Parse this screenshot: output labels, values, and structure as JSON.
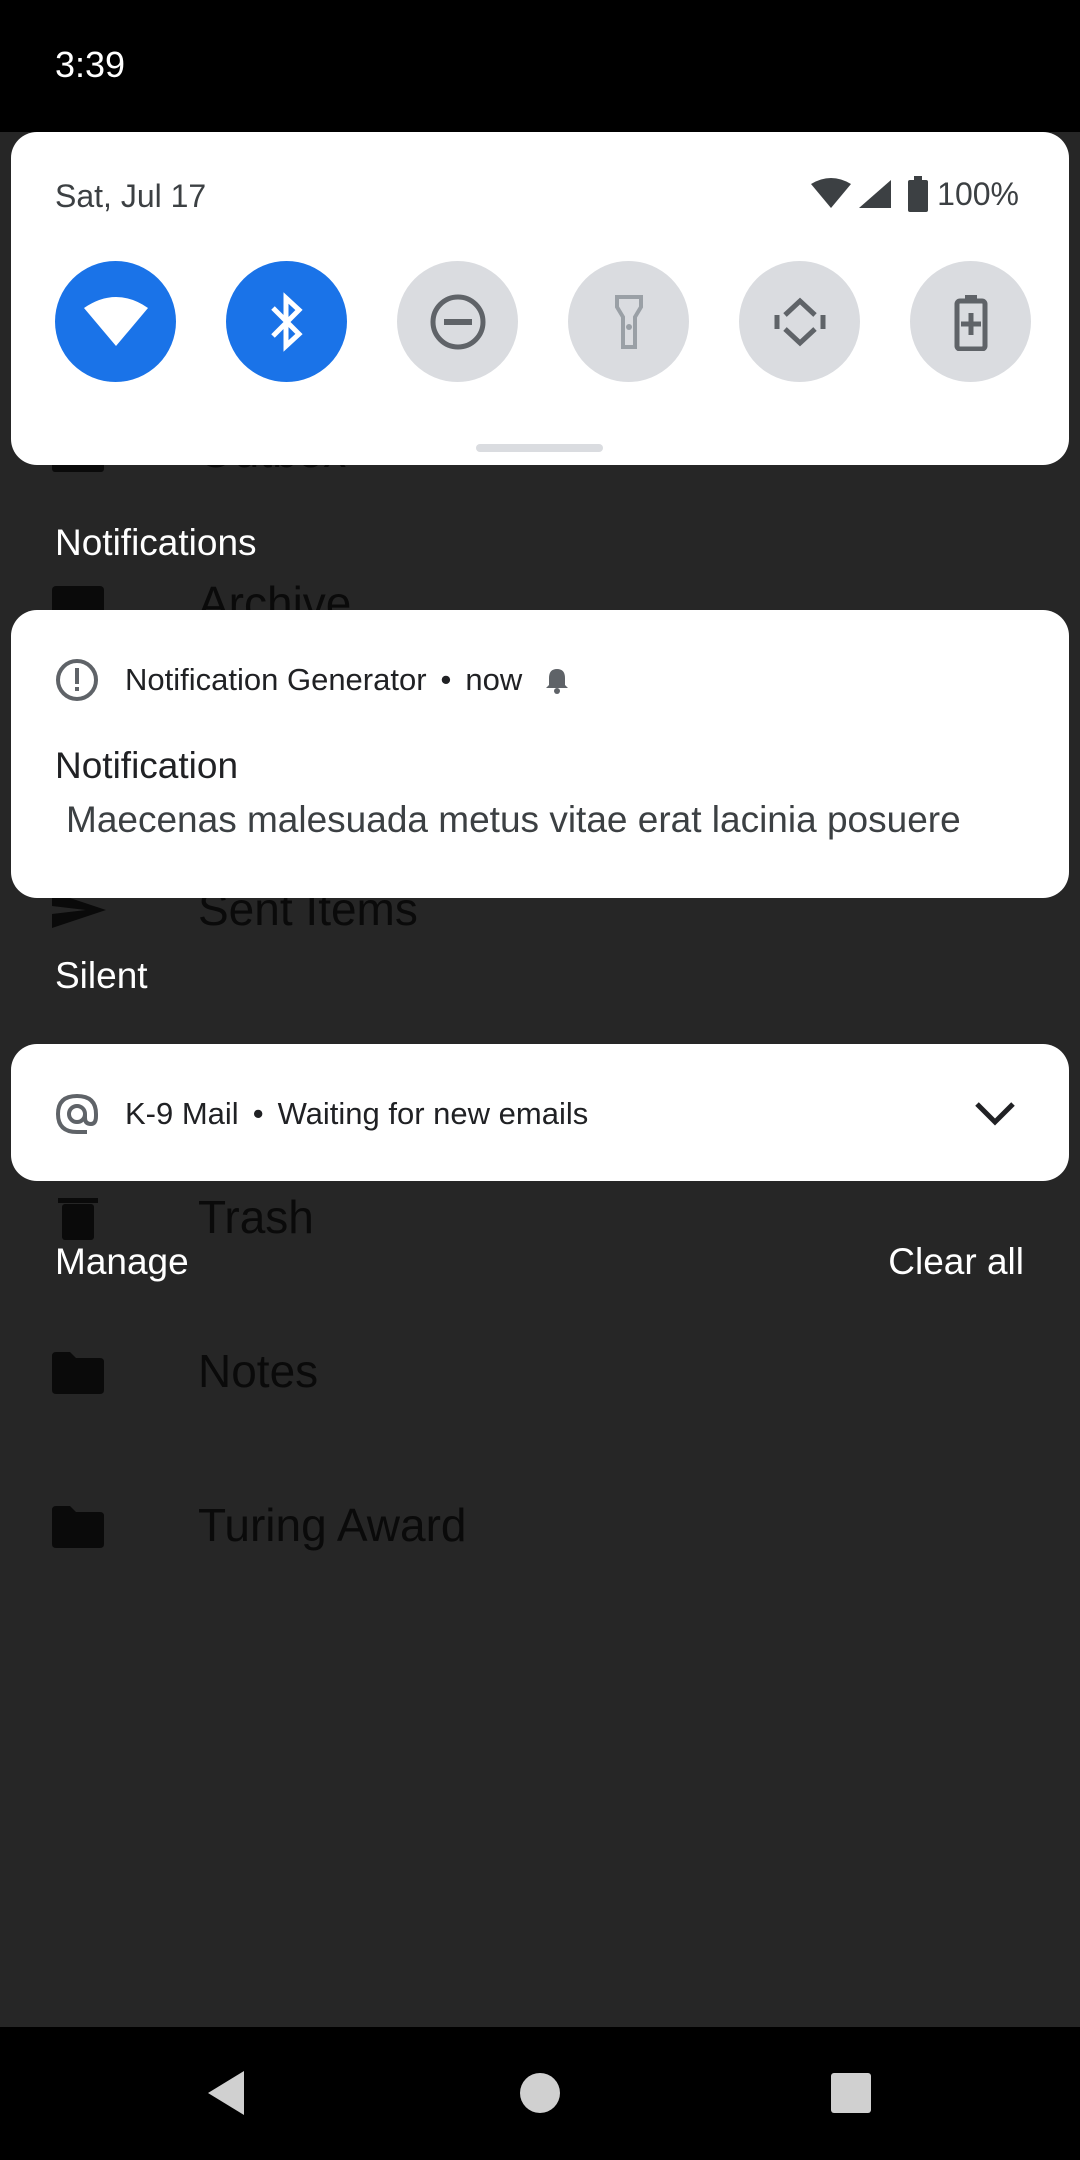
{
  "status_bar": {
    "time": "3:39"
  },
  "background_app": {
    "folders": [
      {
        "label": "Outbox",
        "icon": "outbox-icon"
      },
      {
        "label": "Archive",
        "icon": "archive-icon"
      },
      {
        "label": "Sent Items",
        "icon": "send-icon"
      },
      {
        "label": "Trash",
        "icon": "trash-icon"
      },
      {
        "label": "Notes",
        "icon": "folder-icon"
      },
      {
        "label": "Turing Award",
        "icon": "folder-icon"
      }
    ]
  },
  "quick_settings": {
    "date": "Sat, Jul 17",
    "battery_percent": "100%",
    "tiles": [
      {
        "name": "wifi",
        "icon": "wifi-icon",
        "active": true
      },
      {
        "name": "bluetooth",
        "icon": "bluetooth-icon",
        "active": true
      },
      {
        "name": "do-not-disturb",
        "icon": "do-not-disturb-icon",
        "active": false
      },
      {
        "name": "flashlight",
        "icon": "flashlight-icon",
        "active": false
      },
      {
        "name": "auto-rotate",
        "icon": "auto-rotate-icon",
        "active": false
      },
      {
        "name": "battery-saver",
        "icon": "battery-saver-icon",
        "active": false
      }
    ],
    "accent_color": "#1a73e8",
    "inactive_color": "#dadce0"
  },
  "notifications": {
    "section_label": "Notifications",
    "items": [
      {
        "app_name": "Notification Generator",
        "time": "now",
        "title": "Notification",
        "body": "Maecenas malesuada metus vitae erat lacinia posuere"
      }
    ]
  },
  "silent": {
    "section_label": "Silent",
    "items": [
      {
        "app_name": "K-9 Mail",
        "text": "Waiting for new emails"
      }
    ]
  },
  "footer": {
    "manage_label": "Manage",
    "clear_all_label": "Clear all"
  }
}
